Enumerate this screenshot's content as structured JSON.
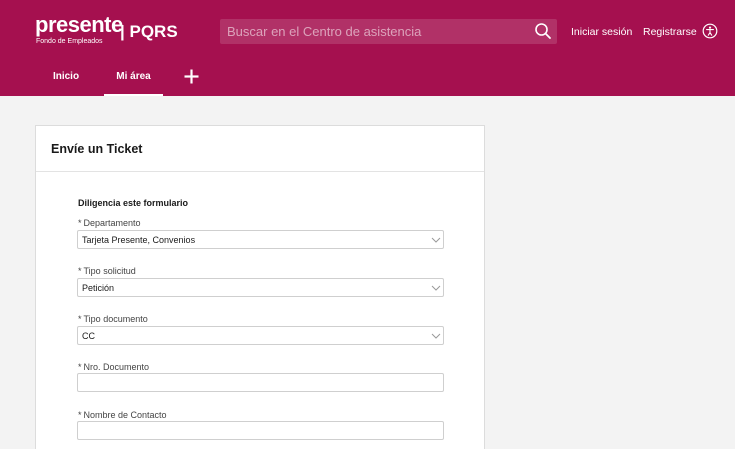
{
  "header": {
    "logo": {
      "brand": "presente",
      "tagline": "Fondo de Empleados"
    },
    "portal_title": "| PQRS",
    "search": {
      "placeholder": "Buscar en el Centro de asistencia",
      "value": ""
    },
    "login_label": "Iniciar sesión",
    "register_label": "Registrarse",
    "accessibility_icon": "accessibility-icon",
    "search_icon": "search-icon",
    "colors": {
      "brand": "#a5104f",
      "text": "#ffffff"
    }
  },
  "nav": {
    "tabs": [
      {
        "label": "Inicio",
        "active": false
      },
      {
        "label": "Mi área",
        "active": true
      }
    ],
    "add_icon": "plus-icon"
  },
  "card": {
    "title": "Envíe un Ticket",
    "form_title": "Diligencia este formulario",
    "fields": [
      {
        "label": "Departamento",
        "required": true,
        "type": "select",
        "value": "Tarjeta Presente, Convenios"
      },
      {
        "label": "Tipo solicitud",
        "required": true,
        "type": "select",
        "value": "Petición"
      },
      {
        "label": "Tipo documento",
        "required": true,
        "type": "select",
        "value": "CC"
      },
      {
        "label": "Nro. Documento",
        "required": true,
        "type": "text",
        "value": ""
      },
      {
        "label": "Nombre de Contacto",
        "required": true,
        "type": "text",
        "value": ""
      }
    ],
    "required_marker": "*"
  }
}
